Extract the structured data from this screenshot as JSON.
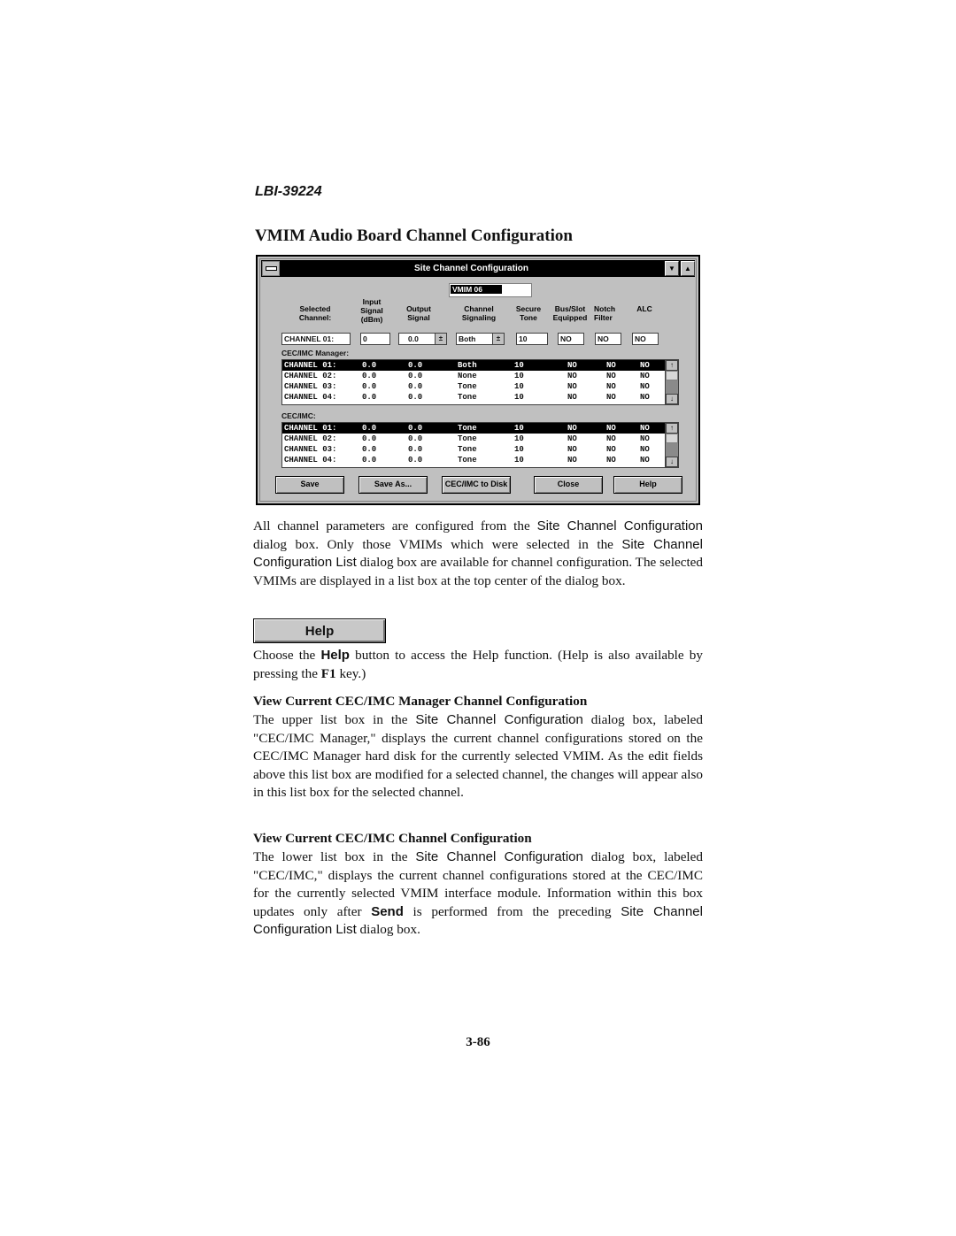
{
  "header": {
    "doc_id": "LBI-39224",
    "title": "VMIM Audio Board Channel Configuration"
  },
  "dialog": {
    "title": "Site Channel Configuration",
    "system_menu_icon": "system-menu-icon",
    "minimize_icon": "▼",
    "maximize_icon": "▲",
    "vmim_selected": "VMIM 06",
    "columns": [
      "Selected\nChannel:",
      "Input\nSignal\n(dBm)",
      "Output\nSignal",
      "Channel\nSignaling",
      "Secure\nTone",
      "Bus/Slot\nEquipped",
      "Notch\nFilter",
      "ALC"
    ],
    "fields": {
      "selected_channel": "CHANNEL 01:",
      "input_signal": "0",
      "output_signal": "0.0",
      "channel_signaling": "Both",
      "secure_tone": "10",
      "bus_slot_equipped": "NO",
      "notch_filter": "NO",
      "alc": "NO"
    },
    "spin_icon": "±",
    "manager_label": "CEC/IMC Manager:",
    "manager_rows": [
      [
        "CHANNEL 01:",
        "0.0",
        "0.0",
        "Both",
        "10",
        "NO",
        "NO",
        "NO"
      ],
      [
        "CHANNEL 02:",
        "0.0",
        "0.0",
        "None",
        "10",
        "NO",
        "NO",
        "NO"
      ],
      [
        "CHANNEL 03:",
        "0.0",
        "0.0",
        "Tone",
        "10",
        "NO",
        "NO",
        "NO"
      ],
      [
        "CHANNEL 04:",
        "0.0",
        "0.0",
        "Tone",
        "10",
        "NO",
        "NO",
        "NO"
      ]
    ],
    "cecimc_label": "CEC/IMC:",
    "cecimc_rows": [
      [
        "CHANNEL 01:",
        "0.0",
        "0.0",
        "Tone",
        "10",
        "NO",
        "NO",
        "NO"
      ],
      [
        "CHANNEL 02:",
        "0.0",
        "0.0",
        "Tone",
        "10",
        "NO",
        "NO",
        "NO"
      ],
      [
        "CHANNEL 03:",
        "0.0",
        "0.0",
        "Tone",
        "10",
        "NO",
        "NO",
        "NO"
      ],
      [
        "CHANNEL 04:",
        "0.0",
        "0.0",
        "Tone",
        "10",
        "NO",
        "NO",
        "NO"
      ]
    ],
    "scroll_up": "↑",
    "scroll_down": "↓",
    "buttons": {
      "save": "Save",
      "save_as": "Save As...",
      "to_disk": "CEC/IMC to Disk",
      "close": "Close",
      "help": "Help"
    }
  },
  "body": {
    "p1": {
      "a": "All channel parameters are configured from the ",
      "b": "Site Channel Configuration",
      "c": " dialog box.  Only those VMIMs which were selected in the ",
      "d": "Site Channel Configuration List",
      "e": " dialog box are available for channel configuration.  The selected VMIMs are displayed in a list box at the top center of the dialog box."
    },
    "help_button": "Help",
    "p2": {
      "a": "Choose the ",
      "b": "Help",
      "c": " button to access the Help function. (Help is also available by pressing the ",
      "d": "F1",
      "e": " key.)"
    },
    "h1": "View Current CEC/IMC Manager Channel Configuration",
    "p3": {
      "a": "The upper list box in the ",
      "b": "Site Channel Configuration",
      "c": " dialog box, labeled \"CEC/IMC Manager,\" displays the current channel configurations stored on the CEC/IMC Manager hard disk for the currently selected VMIM.  As the edit fields above this list box are modified for a selected channel, the changes will appear also in this list box for the selected channel."
    },
    "h2": "View Current CEC/IMC Channel Configuration",
    "p4": {
      "a": "The lower list box in the ",
      "b": "Site Channel Configuration",
      "c": " dialog box, labeled \"CEC/IMC,\" displays the current channel configurations stored at the CEC/IMC for the currently selected VMIM interface module. Information within this box updates only after ",
      "d": "Send",
      "e": " is performed from the preceding ",
      "f": "Site Channel Configuration List",
      "g": " dialog box."
    }
  },
  "footer": {
    "page_number": "3-86"
  }
}
